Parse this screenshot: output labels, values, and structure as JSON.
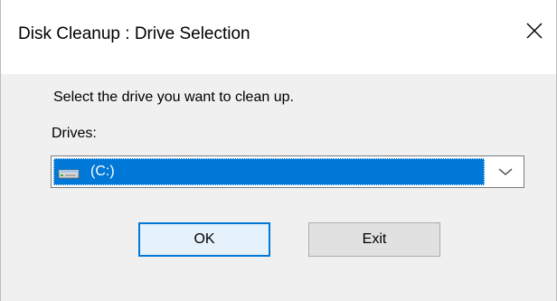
{
  "window": {
    "title": "Disk Cleanup : Drive Selection",
    "close_icon": "close-icon"
  },
  "main": {
    "instruction": "Select the drive you want to clean up.",
    "drives_label": "Drives:",
    "drives_select": {
      "selected_value": "(C:)",
      "icon": "hard-drive-icon",
      "dropdown_icon": "chevron-down-icon"
    }
  },
  "buttons": {
    "ok_label": "OK",
    "exit_label": "Exit"
  },
  "colors": {
    "selection": "#0078d7",
    "client_bg": "#f0f0f0",
    "default_button_border": "#0078d7"
  }
}
